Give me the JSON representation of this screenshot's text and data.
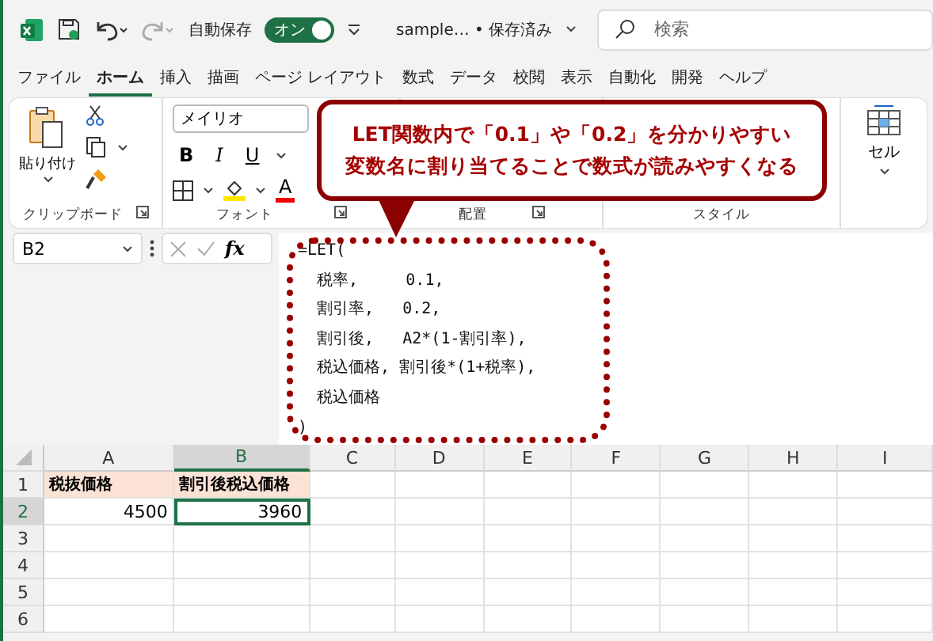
{
  "title_bar": {
    "autosave_label": "自動保存",
    "autosave": {
      "label": "オン",
      "on": true
    },
    "file_name": "sample… • 保存済み",
    "search": {
      "placeholder": "検索"
    }
  },
  "menu_tabs": [
    {
      "label": "ファイル",
      "selected": false
    },
    {
      "label": "ホーム",
      "selected": true
    },
    {
      "label": "挿入",
      "selected": false
    },
    {
      "label": "描画",
      "selected": false
    },
    {
      "label": "ページ レイアウト",
      "selected": false
    },
    {
      "label": "数式",
      "selected": false
    },
    {
      "label": "データ",
      "selected": false
    },
    {
      "label": "校閲",
      "selected": false
    },
    {
      "label": "表示",
      "selected": false
    },
    {
      "label": "自動化",
      "selected": false
    },
    {
      "label": "開発",
      "selected": false
    },
    {
      "label": "ヘルプ",
      "selected": false
    }
  ],
  "ribbon": {
    "paste_label": "貼り付け",
    "font_name": "メイリオ",
    "format_buttons": [
      "B",
      "I",
      "U"
    ],
    "font_color_glyph": "A",
    "cell_label": "セル",
    "group_labels": [
      "クリップボード",
      "フォント",
      "配置",
      "スタイル"
    ]
  },
  "formula_bar": {
    "name_box": "B2",
    "function_label": "fx",
    "formula_lines": [
      "=LET(",
      "  税率,     0.1,",
      "  割引率,   0.2,",
      "  割引後,   A2*(1-割引率),",
      "  税込価格, 割引後*(1+税率),",
      "  税込価格",
      ")"
    ]
  },
  "callout": {
    "lines": [
      "LET関数内で「0.1」や「0.2」を分かりやすい",
      "変数名に割り当てることで数式が読みやすくなる"
    ]
  },
  "sheet": {
    "columns": [
      {
        "label": "A",
        "selected": false
      },
      {
        "label": "B",
        "selected": true
      },
      {
        "label": "C",
        "selected": false
      },
      {
        "label": "D",
        "selected": false
      },
      {
        "label": "E",
        "selected": false
      },
      {
        "label": "F",
        "selected": false
      },
      {
        "label": "G",
        "selected": false
      },
      {
        "label": "H",
        "selected": false
      },
      {
        "label": "I",
        "selected": false
      }
    ],
    "rows": [
      {
        "label": "1",
        "selected": false,
        "cells": [
          {
            "value": "税抜価格",
            "kind": "header",
            "selected": false
          },
          {
            "value": "割引後税込価格",
            "kind": "header",
            "selected": false
          }
        ]
      },
      {
        "label": "2",
        "selected": true,
        "cells": [
          {
            "value": "4500",
            "kind": "number",
            "selected": false
          },
          {
            "value": "3960",
            "kind": "number",
            "selected": true
          }
        ]
      },
      {
        "label": "3",
        "selected": false,
        "cells": []
      },
      {
        "label": "4",
        "selected": false,
        "cells": []
      },
      {
        "label": "5",
        "selected": false,
        "cells": []
      },
      {
        "label": "6",
        "selected": false,
        "cells": []
      }
    ]
  }
}
